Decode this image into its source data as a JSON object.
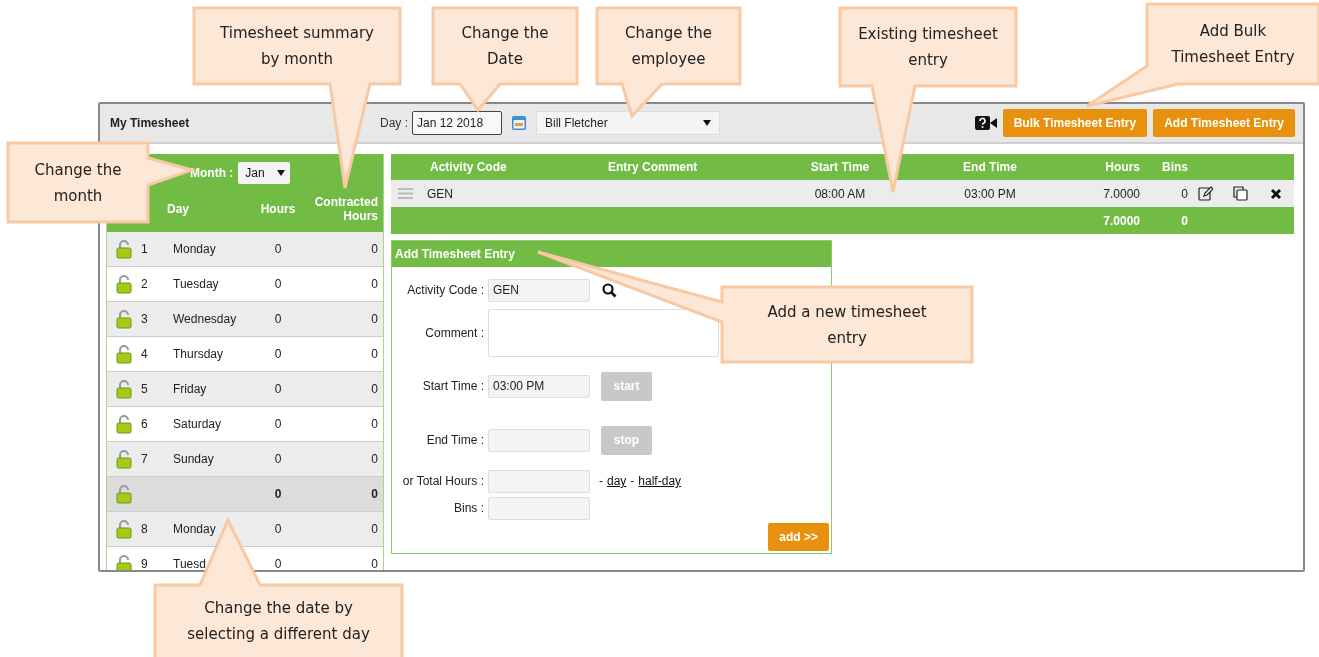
{
  "header": {
    "title": "My Timesheet",
    "day_label": "Day :",
    "day_value": "Jan 12 2018",
    "employee": "Bill Fletcher",
    "buttons": [
      "Bulk Timesheet Entry",
      "Add Timesheet Entry"
    ]
  },
  "summary": {
    "month_label": "Month :",
    "month": "Jan",
    "columns": [
      "Day",
      "Hours",
      "Contracted Hours"
    ],
    "rows": [
      {
        "kind": "day",
        "number": "1",
        "day": "Monday",
        "hours": "0",
        "contracted": "0",
        "locked": false
      },
      {
        "kind": "day",
        "number": "2",
        "day": "Tuesday",
        "hours": "0",
        "contracted": "0",
        "locked": false
      },
      {
        "kind": "day",
        "number": "3",
        "day": "Wednesday",
        "hours": "0",
        "contracted": "0",
        "locked": false
      },
      {
        "kind": "day",
        "number": "4",
        "day": "Thursday",
        "hours": "0",
        "contracted": "0",
        "locked": false
      },
      {
        "kind": "day",
        "number": "5",
        "day": "Friday",
        "hours": "0",
        "contracted": "0",
        "locked": false
      },
      {
        "kind": "day",
        "number": "6",
        "day": "Saturday",
        "hours": "0",
        "contracted": "0",
        "locked": false
      },
      {
        "kind": "day",
        "number": "7",
        "day": "Sunday",
        "hours": "0",
        "contracted": "0",
        "locked": false
      },
      {
        "kind": "total",
        "hours": "0",
        "contracted": "0",
        "locked": false
      },
      {
        "kind": "day",
        "number": "8",
        "day": "Monday",
        "hours": "0",
        "contracted": "0",
        "locked": false
      },
      {
        "kind": "day",
        "number": "9",
        "day": "Tuesd",
        "hours": "0",
        "contracted": "0",
        "locked": false
      }
    ]
  },
  "entries": {
    "columns": [
      "Activity Code",
      "Entry Comment",
      "Start Time",
      "End Time",
      "Hours",
      "Bins"
    ],
    "rows": [
      {
        "activity_code": "GEN",
        "start": "08:00 AM",
        "end": "03:00 PM",
        "hours": "7.0000",
        "bins": "0"
      }
    ],
    "totals": {
      "hours": "7.0000",
      "bins": "0"
    }
  },
  "form": {
    "title": "Add Timesheet Entry",
    "fields": [
      {
        "kind": "lookup",
        "label": "Activity Code :",
        "value": "GEN"
      },
      {
        "kind": "textarea",
        "label": "Comment :"
      },
      {
        "kind": "timer",
        "label": "Start Time :",
        "value": "03:00 PM",
        "button": "start",
        "disabled": true
      },
      {
        "kind": "timer",
        "label": "End Time :",
        "button": "stop",
        "disabled": true
      },
      {
        "kind": "hours",
        "label": "or Total Hours :",
        "separator": "-",
        "links": [
          "day",
          "half-day"
        ]
      },
      {
        "kind": "plain",
        "label": "Bins :"
      }
    ],
    "add_button": "add >>"
  },
  "callouts": [
    "Timesheet summary by month",
    "Change the Date",
    "Change the employee",
    "Existing timesheet entry",
    "Add Bulk Timesheet Entry",
    "Change the month",
    "Add a new timesheet entry",
    "Change the date by selecting a different day"
  ]
}
